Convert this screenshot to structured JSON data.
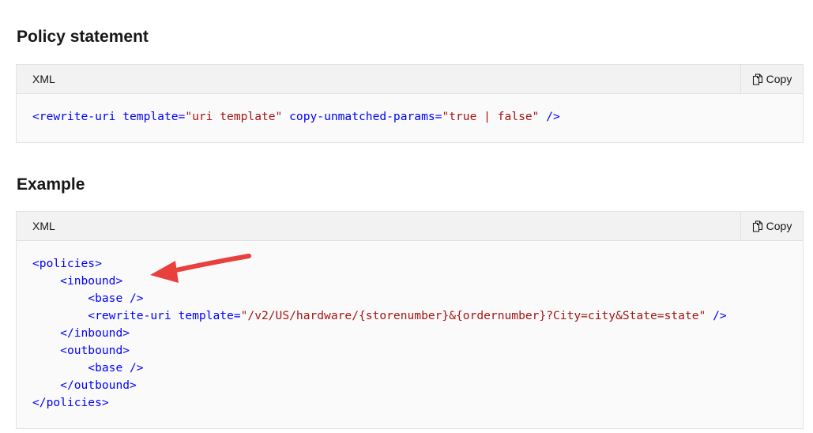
{
  "sections": [
    {
      "heading": "Policy statement",
      "language": "XML",
      "copy_label": "Copy"
    },
    {
      "heading": "Example",
      "language": "XML",
      "copy_label": "Copy"
    }
  ],
  "statement_code": {
    "tag_open": "<rewrite-uri",
    "attr_template": "template",
    "eq1": "=",
    "val_template": "\"uri template\"",
    "attr_copy": "copy-unmatched-params",
    "eq2": "=",
    "val_copy": "\"true | false\"",
    "tag_close": "/>"
  },
  "example_code": {
    "policies_open": "<policies>",
    "inbound_open": "<inbound>",
    "base_1": "<base />",
    "rewrite_open": "<rewrite-uri",
    "rewrite_attr": "template",
    "rewrite_eq": "=",
    "rewrite_val": "\"/v2/US/hardware/{storenumber}&{ordernumber}?City=city&State=state\"",
    "rewrite_close": "/>",
    "inbound_close": "</inbound>",
    "outbound_open": "<outbound>",
    "base_2": "<base />",
    "outbound_close": "</outbound>",
    "policies_close": "</policies>"
  },
  "colors": {
    "tag": "#0101fd",
    "value": "#a31515",
    "arrow": "#e8413d",
    "code_bg": "#fafafa",
    "header_bg": "#f2f2f2"
  },
  "icons": {
    "copy": "copy-icon",
    "annotation": "red-arrow-icon"
  }
}
